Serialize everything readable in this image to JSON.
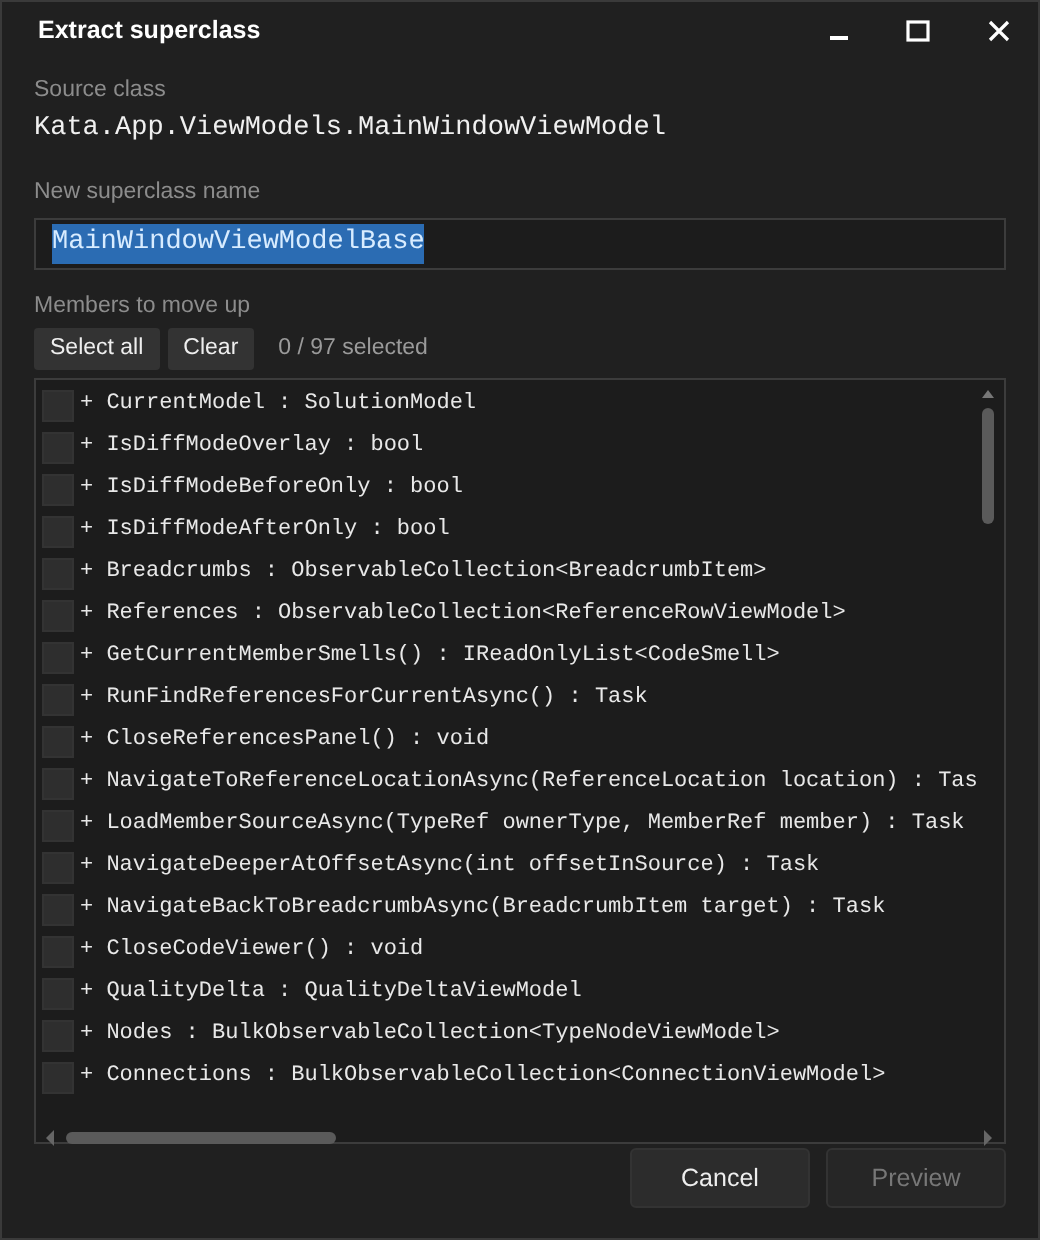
{
  "window": {
    "title": "Extract superclass"
  },
  "source_class": {
    "label": "Source class",
    "value": "Kata.App.ViewModels.MainWindowViewModel"
  },
  "superclass_name": {
    "label": "New superclass name",
    "value": "MainWindowViewModelBase",
    "text_selected": true
  },
  "members": {
    "label": "Members to move up",
    "buttons": [
      "Select all",
      "Clear"
    ],
    "count": "0 / 97 selected",
    "items": [
      {
        "text": "+ CurrentModel : SolutionModel",
        "checked": false
      },
      {
        "text": "+ IsDiffModeOverlay : bool",
        "checked": false
      },
      {
        "text": "+ IsDiffModeBeforeOnly : bool",
        "checked": false
      },
      {
        "text": "+ IsDiffModeAfterOnly : bool",
        "checked": false
      },
      {
        "text": "+ Breadcrumbs : ObservableCollection<BreadcrumbItem>",
        "checked": false
      },
      {
        "text": "+ References : ObservableCollection<ReferenceRowViewModel>",
        "checked": false
      },
      {
        "text": "+ GetCurrentMemberSmells() : IReadOnlyList<CodeSmell>",
        "checked": false
      },
      {
        "text": "+ RunFindReferencesForCurrentAsync() : Task",
        "checked": false
      },
      {
        "text": "+ CloseReferencesPanel() : void",
        "checked": false
      },
      {
        "text": "+ NavigateToReferenceLocationAsync(ReferenceLocation location) : Tas",
        "checked": false
      },
      {
        "text": "+ LoadMemberSourceAsync(TypeRef ownerType, MemberRef member) : Task",
        "checked": false
      },
      {
        "text": "+ NavigateDeeperAtOffsetAsync(int offsetInSource) : Task",
        "checked": false
      },
      {
        "text": "+ NavigateBackToBreadcrumbAsync(BreadcrumbItem target) : Task",
        "checked": false
      },
      {
        "text": "+ CloseCodeViewer() : void",
        "checked": false
      },
      {
        "text": "+ QualityDelta : QualityDeltaViewModel",
        "checked": false
      },
      {
        "text": "+ Nodes : BulkObservableCollection<TypeNodeViewModel>",
        "checked": false
      },
      {
        "text": "+ Connections : BulkObservableCollection<ConnectionViewModel>",
        "checked": false
      }
    ]
  },
  "footer_buttons": [
    {
      "label": "Cancel",
      "disabled": false
    },
    {
      "label": "Preview",
      "disabled": true
    }
  ]
}
